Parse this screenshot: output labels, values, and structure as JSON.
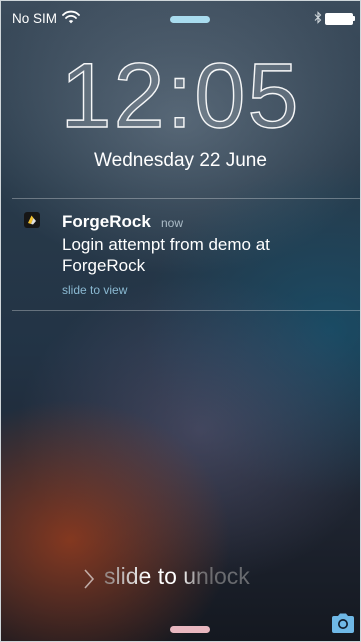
{
  "status_bar": {
    "carrier": "No SIM",
    "wifi_icon": "wifi-icon",
    "bluetooth_icon": "bluetooth-icon",
    "battery_level": 1.0
  },
  "lock_screen": {
    "time": "12:05",
    "date": "Wednesday 22 June"
  },
  "notification": {
    "app_name": "ForgeRock",
    "time": "now",
    "message": "Login attempt from demo at ForgeRock",
    "action_hint": "slide to view",
    "app_icon": "forgerock-logo-icon"
  },
  "unlock": {
    "label": "slide to unlock",
    "chevron_icon": "chevron-right-icon"
  },
  "camera_icon": "camera-icon",
  "colors": {
    "top_grabber": "#a9dcef",
    "bottom_grabber": "#e8b7c0",
    "camera": "#6fb8e6",
    "link": "#96c8e1"
  }
}
